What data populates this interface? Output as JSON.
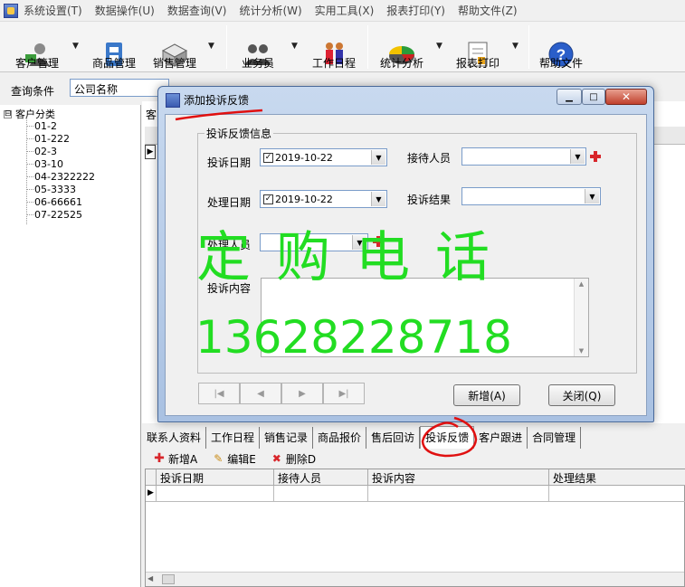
{
  "menu": [
    "系统设置(T)",
    "数据操作(U)",
    "数据查询(V)",
    "统计分析(W)",
    "实用工具(X)",
    "报表打印(Y)",
    "帮助文件(Z)"
  ],
  "toolbar": {
    "customer": "客户管理",
    "product": "商品管理",
    "sales": "销售管理",
    "staff": "业务员",
    "schedule": "工作日程",
    "stats": "统计分析",
    "report": "报表打印",
    "help": "帮助文件"
  },
  "query": {
    "label": "查询条件",
    "field": "公司名称"
  },
  "tree": {
    "root": "客户分类",
    "expander": "⊟",
    "nodes": [
      "01-2",
      "01-222",
      "02-3",
      "03-10",
      "04-2322222",
      "05-3333",
      "06-66661",
      "07-22525"
    ]
  },
  "right_header": "客",
  "dialog": {
    "title": "添加投诉反馈",
    "group_title": "投诉反馈信息",
    "complaint_date_label": "投诉日期",
    "complaint_date": "2019-10-22",
    "handle_date_label": "处理日期",
    "handle_date": "2019-10-22",
    "receptionist_label": "接待人员",
    "result_label": "投诉结果",
    "handler_label": "处理人员",
    "content_label": "投诉内容",
    "add_button": "新增(A)",
    "close_button": "关闭(Q)"
  },
  "watermark": {
    "text": "定购电话",
    "phone": "13628228718"
  },
  "tabs": [
    "联系人资料",
    "工作日程",
    "销售记录",
    "商品报价",
    "售后回访",
    "投诉反馈",
    "客户跟进",
    "合同管理"
  ],
  "active_tab": "投诉反馈",
  "subtoolbar": {
    "add": "新增A",
    "edit": "编辑E",
    "delete": "删除D"
  },
  "grid_headers": [
    "投诉日期",
    "接待人员",
    "投诉内容",
    "处理结果"
  ],
  "colors": {
    "watermark": "#22dd22",
    "annotation": "#e01010",
    "plus": "#d8262b"
  }
}
